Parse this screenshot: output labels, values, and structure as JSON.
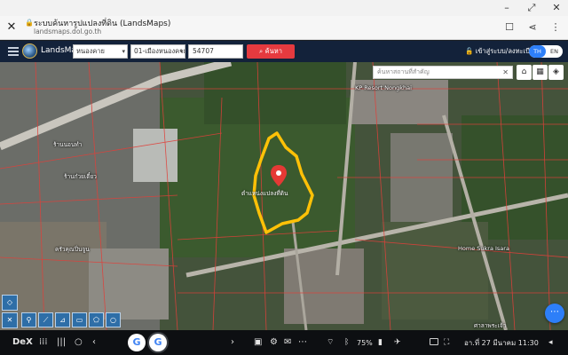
{
  "browser": {
    "title": "ระบบค้นหารูปแปลงที่ดิน (LandsMaps)",
    "url": "landsmaps.dol.go.th"
  },
  "nav": {
    "brand": "LandsMaps",
    "province": "หนองคาย",
    "district": "01-เมืองหนองคาย",
    "parcel_no": "54707",
    "search_label": "ค้นหา",
    "login_label": "เข้าสู่ระบบ/ลงทะเบียน",
    "lang_th": "TH",
    "lang_en": "EN"
  },
  "map": {
    "place_search_placeholder": "ค้นหาสถานที่สำคัญ",
    "pin_label": "ตำแหน่งแปลงที่ดิน",
    "labels": [
      "KP Resort Nongkhai",
      "Home Sukra Isara",
      "ร้านนอนทำ",
      "ร้านก๋วยเตี๋ยว",
      "ครัวคุณปิ่นจูน",
      "ศาลาพระเจ้า"
    ],
    "parcel_outline_color": "#ffc107",
    "pin_color": "#e53935",
    "parcel_line_color": "#e0403a"
  },
  "taskbar": {
    "dex_label": "DeX",
    "battery": "75%",
    "datetime": "อา.ที่ 27 มีนาคม 11:30"
  }
}
